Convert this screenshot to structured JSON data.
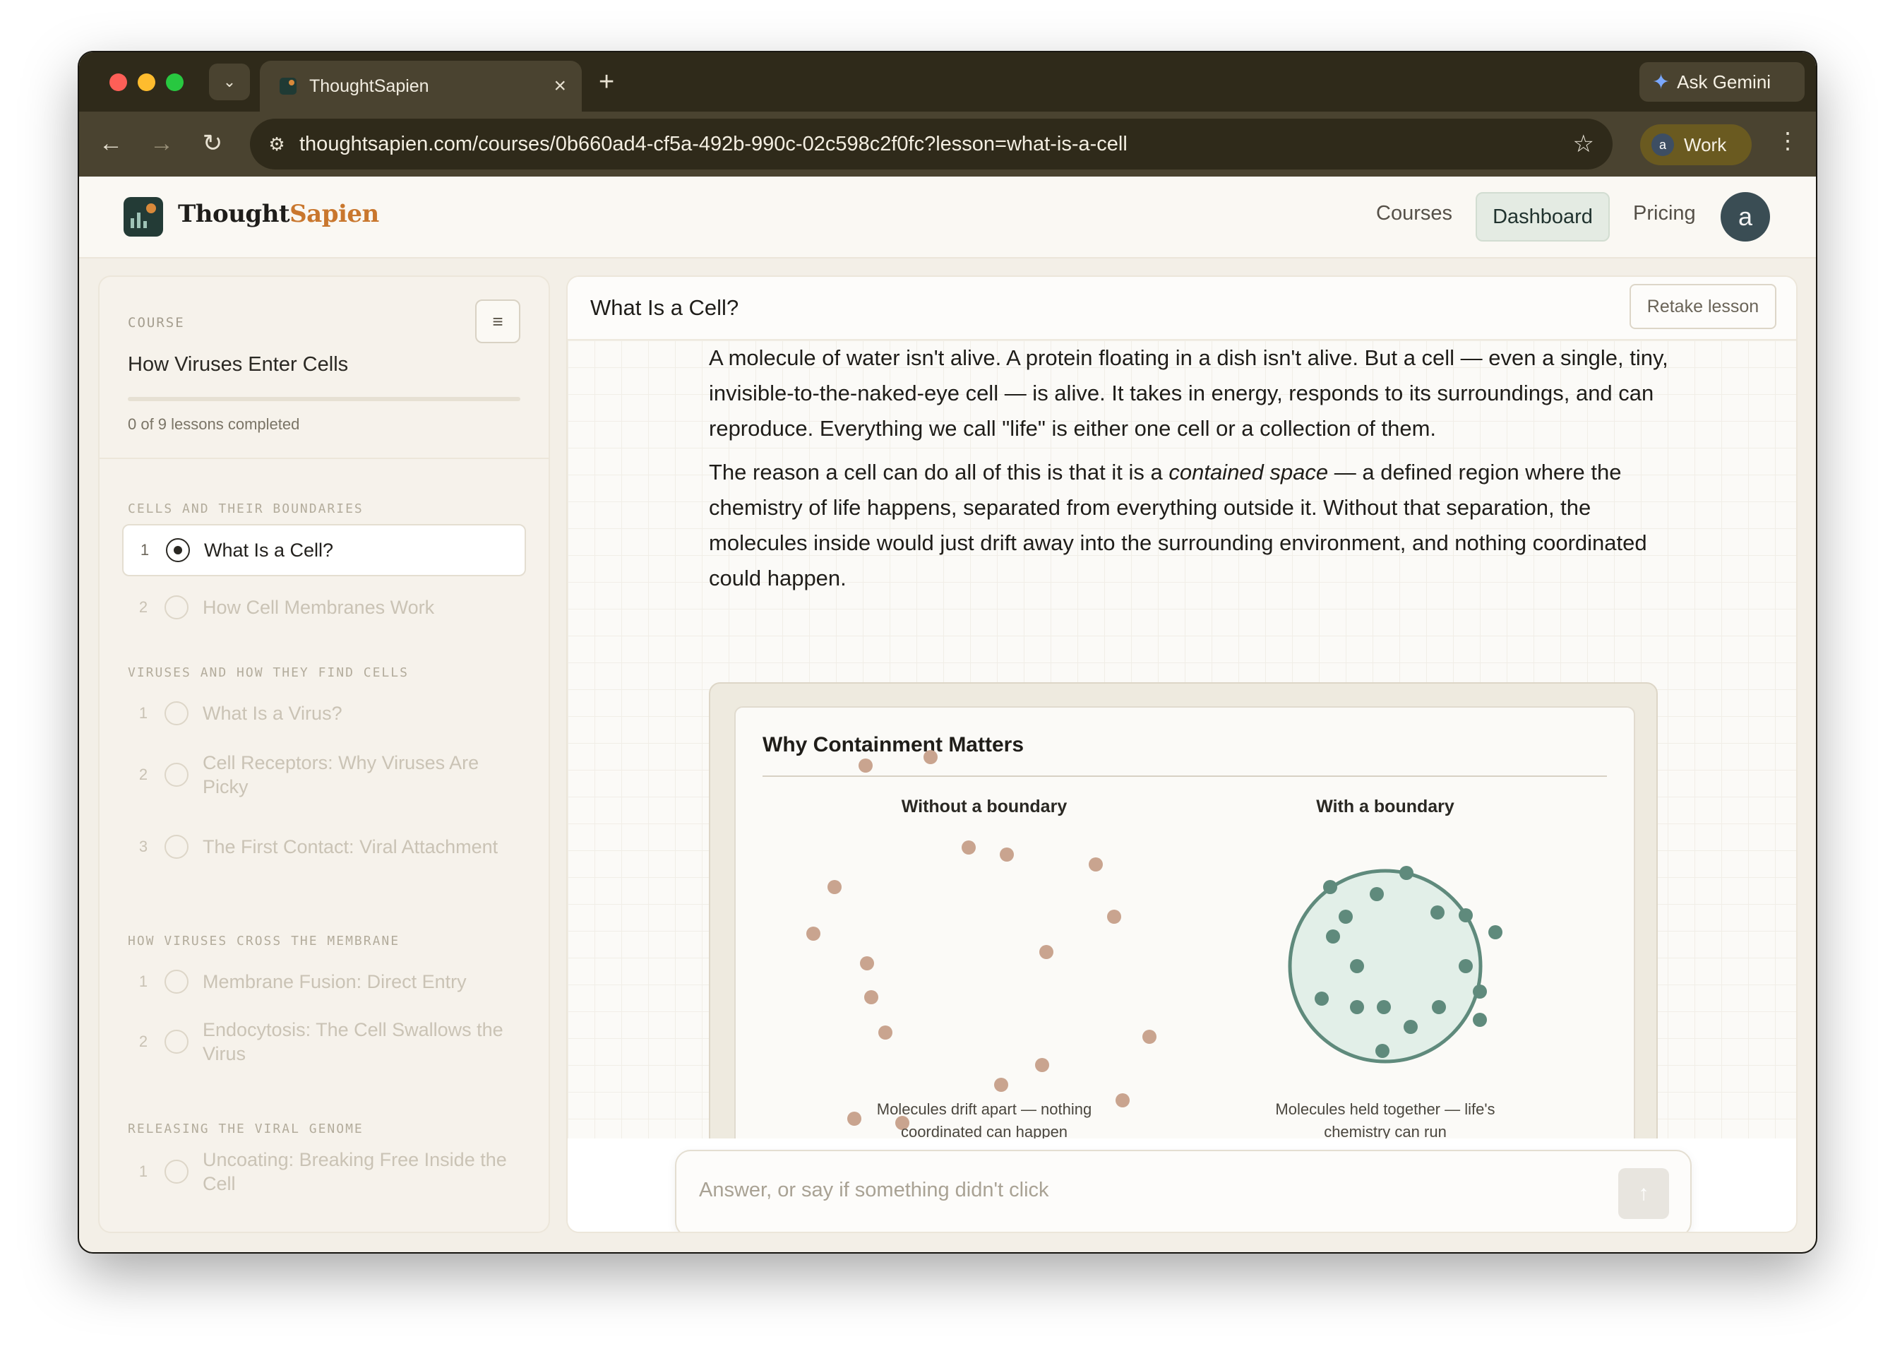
{
  "browser": {
    "tab_title": "ThoughtSapien",
    "new_tab": "+",
    "ask_gemini": "Ask Gemini",
    "url": "thoughtsapien.com/courses/0b660ad4-cf5a-492b-990c-02c598c2f0fc?lesson=what-is-a-cell",
    "profile_initial": "a",
    "profile_label": "Work"
  },
  "site": {
    "logo_main": "Thought",
    "logo_accent": "Sapien",
    "nav": {
      "courses": "Courses",
      "dashboard": "Dashboard",
      "pricing": "Pricing"
    },
    "avatar_initial": "a"
  },
  "sidebar": {
    "course_label": "COURSE",
    "course_title": "How Viruses Enter Cells",
    "progress_fraction": 0,
    "progress_text": "0 of 9 lessons completed",
    "sections": [
      {
        "label": "CELLS AND THEIR BOUNDARIES",
        "lessons": [
          {
            "num": "1",
            "title": "What Is a Cell?",
            "active": true
          },
          {
            "num": "2",
            "title": "How Cell Membranes Work",
            "active": false
          }
        ]
      },
      {
        "label": "VIRUSES AND HOW THEY FIND CELLS",
        "lessons": [
          {
            "num": "1",
            "title": "What Is a Virus?",
            "active": false
          },
          {
            "num": "2",
            "title": "Cell Receptors: Why Viruses Are Picky",
            "active": false
          },
          {
            "num": "3",
            "title": "The First Contact: Viral Attachment",
            "active": false
          }
        ]
      },
      {
        "label": "HOW VIRUSES CROSS THE MEMBRANE",
        "lessons": [
          {
            "num": "1",
            "title": "Membrane Fusion: Direct Entry",
            "active": false
          },
          {
            "num": "2",
            "title": "Endocytosis: The Cell Swallows the Virus",
            "active": false
          }
        ]
      },
      {
        "label": "RELEASING THE VIRAL GENOME",
        "lessons": [
          {
            "num": "1",
            "title": "Uncoating: Breaking Free Inside the Cell",
            "active": false
          }
        ]
      }
    ]
  },
  "lesson": {
    "title": "What Is a Cell?",
    "retake_label": "Retake lesson",
    "paragraph1": "A molecule of water isn't alive. A protein floating in a dish isn't alive. But a cell — even a single, tiny, invisible-to-the-naked-eye cell — is alive. It takes in energy, responds to its surroundings, and can reproduce. Everything we call \"life\" is either one cell or a collection of them.",
    "paragraph2_before": "The reason a cell can do all of this is that it is a ",
    "paragraph2_em": "contained space",
    "paragraph2_after": " — a defined region where the chemistry of life happens, separated from everything outside it. Without that separation, the molecules inside would just drift away into the surrounding environment, and nothing coordinated could happen.",
    "figure": {
      "title": "Why Containment Matters",
      "left_heading": "Without a boundary",
      "right_heading": "With a boundary",
      "left_caption": "Molecules drift apart — nothing coordinated can happen",
      "right_caption": "Molecules held together — life's chemistry can run",
      "colors": {
        "free_molecule": "#c9a48f",
        "held_molecule": "#5f8a7c",
        "membrane": "#5f8a7c",
        "cell_fill": "#e2efe8"
      }
    }
  },
  "chat": {
    "placeholder": "Answer, or say if something didn't click",
    "send_icon": "arrow-up-icon"
  }
}
